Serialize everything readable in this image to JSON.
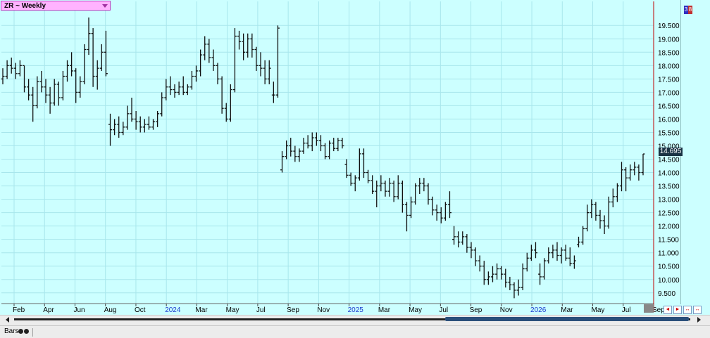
{
  "window": {
    "title": "ZR ~ Weekly",
    "last_price": "14.695",
    "status_label": "Bars",
    "nav_buttons": [
      "◄",
      "►",
      "↔",
      "↔"
    ],
    "badges": [
      "3",
      "8"
    ]
  },
  "colors": {
    "background": "#ccffff",
    "grid": "#a8e6ec",
    "bars": "#111111",
    "title_box": "#ffb3ff",
    "price_tag": "#1a3344",
    "cursor_line": "#c00000",
    "year_label": "#1a3ccf"
  },
  "chart_data": {
    "type": "ohlc",
    "ylim": [
      9.1,
      20.4
    ],
    "y_ticks": [
      "19.500",
      "19.000",
      "18.500",
      "18.000",
      "17.500",
      "17.000",
      "16.500",
      "16.000",
      "15.500",
      "15.000",
      "14.500",
      "14.000",
      "13.500",
      "13.000",
      "12.500",
      "12.000",
      "11.500",
      "11.000",
      "10.500",
      "10.000",
      "9.500"
    ],
    "x_labels": [
      {
        "label": "Feb",
        "year": false
      },
      {
        "label": "Apr",
        "year": false
      },
      {
        "label": "Jun",
        "year": false
      },
      {
        "label": "Aug",
        "year": false
      },
      {
        "label": "Oct",
        "year": false
      },
      {
        "label": "2024",
        "year": true
      },
      {
        "label": "Mar",
        "year": false
      },
      {
        "label": "May",
        "year": false
      },
      {
        "label": "Jul",
        "year": false
      },
      {
        "label": "Sep",
        "year": false
      },
      {
        "label": "Nov",
        "year": false
      },
      {
        "label": "2025",
        "year": true
      },
      {
        "label": "Mar",
        "year": false
      },
      {
        "label": "May",
        "year": false
      },
      {
        "label": "Jul",
        "year": false
      },
      {
        "label": "Sep",
        "year": false
      },
      {
        "label": "Nov",
        "year": false
      },
      {
        "label": "2026",
        "year": true
      },
      {
        "label": "Mar",
        "year": false
      },
      {
        "label": "May",
        "year": false
      },
      {
        "label": "Jul",
        "year": false
      },
      {
        "label": "Sep",
        "year": false
      }
    ],
    "bars": [
      [
        17.5,
        17.9,
        17.3,
        17.6
      ],
      [
        17.6,
        18.2,
        17.5,
        18.0
      ],
      [
        18.0,
        18.3,
        17.7,
        17.9
      ],
      [
        17.9,
        18.1,
        17.5,
        17.7
      ],
      [
        17.7,
        18.2,
        17.6,
        18.0
      ],
      [
        18.0,
        18.0,
        17.0,
        17.2
      ],
      [
        17.2,
        17.5,
        16.7,
        16.9
      ],
      [
        16.9,
        17.2,
        15.9,
        16.5
      ],
      [
        16.5,
        17.6,
        16.4,
        17.4
      ],
      [
        17.4,
        17.8,
        17.0,
        17.2
      ],
      [
        17.2,
        17.5,
        16.6,
        16.9
      ],
      [
        16.9,
        17.2,
        16.2,
        16.6
      ],
      [
        16.6,
        17.5,
        16.5,
        17.3
      ],
      [
        17.3,
        17.4,
        16.5,
        16.8
      ],
      [
        16.8,
        17.8,
        16.7,
        17.6
      ],
      [
        17.6,
        18.2,
        17.4,
        18.0
      ],
      [
        18.0,
        18.5,
        17.6,
        17.8
      ],
      [
        17.8,
        17.9,
        16.6,
        17.0
      ],
      [
        17.0,
        17.6,
        16.8,
        17.4
      ],
      [
        17.4,
        18.8,
        17.3,
        18.6
      ],
      [
        18.6,
        19.8,
        18.4,
        19.2
      ],
      [
        19.2,
        19.4,
        17.2,
        17.6
      ],
      [
        17.6,
        18.2,
        17.1,
        17.9
      ],
      [
        17.9,
        18.8,
        17.8,
        18.5
      ],
      [
        18.5,
        19.3,
        17.6,
        17.7
      ],
      [
        15.8,
        16.2,
        15.0,
        15.6
      ],
      [
        15.6,
        16.0,
        15.4,
        15.8
      ],
      [
        15.8,
        16.1,
        15.3,
        15.5
      ],
      [
        15.5,
        15.9,
        15.4,
        15.7
      ],
      [
        15.7,
        16.5,
        15.6,
        16.2
      ],
      [
        16.2,
        16.8,
        15.9,
        16.0
      ],
      [
        16.0,
        16.3,
        15.6,
        15.9
      ],
      [
        15.9,
        16.1,
        15.5,
        15.7
      ],
      [
        15.7,
        16.0,
        15.5,
        15.8
      ],
      [
        15.8,
        16.1,
        15.6,
        15.7
      ],
      [
        15.7,
        16.0,
        15.6,
        15.9
      ],
      [
        15.9,
        16.3,
        15.7,
        16.2
      ],
      [
        16.2,
        17.0,
        16.1,
        16.8
      ],
      [
        16.8,
        17.5,
        16.7,
        17.2
      ],
      [
        17.2,
        17.6,
        16.9,
        17.1
      ],
      [
        17.1,
        17.3,
        16.8,
        17.0
      ],
      [
        17.0,
        17.4,
        16.9,
        17.2
      ],
      [
        17.2,
        17.6,
        16.9,
        17.0
      ],
      [
        17.0,
        17.3,
        16.9,
        17.2
      ],
      [
        17.2,
        17.8,
        17.1,
        17.6
      ],
      [
        17.6,
        18.0,
        17.4,
        17.8
      ],
      [
        17.8,
        18.6,
        17.6,
        18.4
      ],
      [
        18.4,
        19.1,
        18.2,
        18.8
      ],
      [
        18.8,
        19.0,
        18.1,
        18.3
      ],
      [
        18.3,
        18.6,
        17.8,
        18.0
      ],
      [
        18.0,
        18.1,
        17.3,
        17.5
      ],
      [
        17.5,
        17.6,
        16.2,
        16.4
      ],
      [
        16.4,
        16.6,
        15.9,
        16.0
      ],
      [
        16.0,
        17.3,
        15.9,
        17.1
      ],
      [
        17.1,
        19.4,
        17.0,
        19.1
      ],
      [
        19.1,
        19.3,
        18.6,
        18.9
      ],
      [
        18.9,
        19.2,
        18.2,
        18.5
      ],
      [
        18.5,
        19.2,
        18.3,
        19.0
      ],
      [
        19.0,
        19.2,
        18.3,
        18.6
      ],
      [
        18.6,
        18.7,
        17.8,
        18.0
      ],
      [
        18.0,
        18.5,
        17.6,
        17.9
      ],
      [
        17.9,
        18.2,
        17.3,
        17.5
      ],
      [
        17.5,
        18.2,
        17.3,
        17.9
      ],
      [
        16.9,
        17.4,
        16.6,
        16.9
      ],
      [
        16.9,
        19.5,
        16.8,
        19.4
      ],
      [
        14.1,
        14.8,
        14.0,
        14.6
      ],
      [
        14.6,
        15.2,
        14.5,
        15.0
      ],
      [
        15.0,
        15.3,
        14.6,
        14.8
      ],
      [
        14.8,
        15.0,
        14.4,
        14.6
      ],
      [
        14.6,
        14.9,
        14.4,
        14.8
      ],
      [
        14.8,
        15.3,
        14.7,
        15.1
      ],
      [
        15.1,
        15.4,
        14.9,
        15.0
      ],
      [
        15.0,
        15.5,
        14.8,
        15.3
      ],
      [
        15.3,
        15.5,
        15.0,
        15.2
      ],
      [
        15.2,
        15.4,
        14.8,
        15.0
      ],
      [
        15.0,
        15.1,
        14.5,
        14.6
      ],
      [
        14.6,
        15.2,
        14.5,
        15.1
      ],
      [
        15.1,
        15.3,
        14.8,
        14.9
      ],
      [
        14.9,
        15.3,
        14.8,
        15.2
      ],
      [
        15.2,
        15.3,
        14.9,
        15.0
      ],
      [
        14.3,
        14.5,
        13.8,
        13.9
      ],
      [
        13.9,
        14.0,
        13.5,
        13.6
      ],
      [
        13.6,
        13.9,
        13.3,
        13.8
      ],
      [
        13.8,
        14.9,
        13.7,
        14.7
      ],
      [
        14.7,
        14.9,
        13.8,
        14.0
      ],
      [
        14.0,
        14.1,
        13.6,
        13.7
      ],
      [
        13.7,
        13.9,
        13.2,
        13.3
      ],
      [
        13.3,
        13.7,
        12.7,
        13.5
      ],
      [
        13.5,
        13.9,
        13.3,
        13.6
      ],
      [
        13.6,
        13.7,
        13.1,
        13.3
      ],
      [
        13.3,
        13.8,
        13.1,
        13.6
      ],
      [
        13.6,
        13.7,
        12.9,
        13.1
      ],
      [
        13.1,
        13.9,
        13.0,
        13.6
      ],
      [
        13.6,
        13.7,
        12.5,
        12.8
      ],
      [
        12.8,
        12.9,
        11.8,
        12.4
      ],
      [
        12.4,
        13.1,
        12.3,
        12.9
      ],
      [
        12.9,
        13.6,
        12.8,
        13.5
      ],
      [
        13.5,
        13.8,
        13.2,
        13.6
      ],
      [
        13.6,
        13.8,
        13.3,
        13.5
      ],
      [
        13.5,
        13.6,
        12.8,
        13.0
      ],
      [
        13.0,
        13.1,
        12.4,
        12.6
      ],
      [
        12.6,
        12.8,
        12.2,
        12.5
      ],
      [
        12.5,
        12.7,
        12.1,
        12.3
      ],
      [
        12.3,
        12.9,
        12.2,
        12.8
      ],
      [
        12.8,
        13.3,
        12.3,
        12.5
      ],
      [
        11.5,
        12.0,
        11.3,
        11.6
      ],
      [
        11.6,
        11.8,
        11.2,
        11.4
      ],
      [
        11.4,
        11.8,
        11.3,
        11.6
      ],
      [
        11.6,
        11.7,
        11.0,
        11.2
      ],
      [
        11.2,
        11.4,
        10.8,
        11.1
      ],
      [
        11.1,
        11.2,
        10.5,
        10.7
      ],
      [
        10.7,
        10.9,
        10.3,
        10.5
      ],
      [
        10.5,
        10.7,
        9.8,
        10.0
      ],
      [
        10.0,
        10.3,
        9.8,
        10.1
      ],
      [
        10.1,
        10.5,
        9.9,
        10.2
      ],
      [
        10.2,
        10.6,
        10.0,
        10.4
      ],
      [
        10.4,
        10.5,
        10.0,
        10.2
      ],
      [
        10.2,
        10.4,
        9.7,
        9.9
      ],
      [
        9.9,
        10.1,
        9.6,
        9.8
      ],
      [
        9.8,
        9.9,
        9.3,
        9.6
      ],
      [
        9.6,
        10.0,
        9.4,
        9.7
      ],
      [
        9.7,
        10.6,
        9.6,
        10.4
      ],
      [
        10.4,
        11.0,
        10.3,
        10.8
      ],
      [
        10.8,
        11.3,
        10.7,
        11.1
      ],
      [
        11.1,
        11.4,
        10.8,
        11.0
      ],
      [
        10.2,
        10.6,
        9.8,
        10.1
      ],
      [
        10.1,
        10.8,
        10.0,
        10.7
      ],
      [
        10.7,
        11.2,
        10.6,
        11.0
      ],
      [
        11.0,
        11.3,
        10.8,
        11.1
      ],
      [
        11.1,
        11.4,
        10.7,
        10.9
      ],
      [
        10.9,
        11.2,
        10.6,
        11.1
      ],
      [
        11.1,
        11.3,
        10.7,
        10.8
      ],
      [
        10.8,
        11.2,
        10.5,
        10.6
      ],
      [
        10.6,
        10.9,
        10.4,
        10.7
      ],
      [
        11.3,
        11.6,
        11.2,
        11.4
      ],
      [
        11.4,
        12.0,
        11.3,
        11.9
      ],
      [
        11.9,
        12.8,
        11.8,
        12.5
      ],
      [
        12.5,
        13.0,
        12.3,
        12.8
      ],
      [
        12.8,
        12.9,
        12.2,
        12.4
      ],
      [
        12.4,
        12.6,
        11.9,
        12.2
      ],
      [
        12.2,
        12.4,
        11.7,
        12.0
      ],
      [
        12.0,
        13.1,
        11.9,
        12.9
      ],
      [
        12.9,
        13.4,
        12.7,
        13.1
      ],
      [
        13.1,
        13.6,
        12.9,
        13.5
      ],
      [
        13.5,
        14.4,
        13.3,
        14.1
      ],
      [
        14.1,
        14.2,
        13.3,
        13.8
      ],
      [
        13.8,
        14.3,
        13.7,
        14.1
      ],
      [
        14.1,
        14.4,
        13.9,
        14.2
      ],
      [
        14.2,
        14.3,
        13.7,
        14.0
      ],
      [
        14.0,
        14.7,
        13.9,
        14.695
      ]
    ],
    "grid": true,
    "last_value_label": "14.695",
    "series_label": "ZR ~ Weekly"
  }
}
